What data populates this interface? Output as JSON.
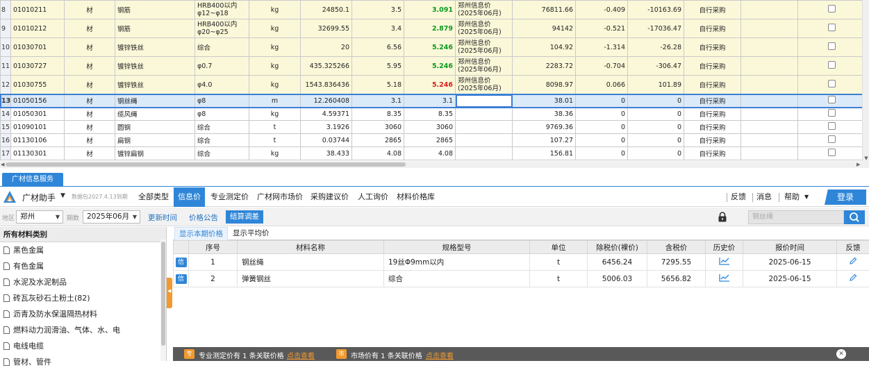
{
  "grid": {
    "rows": [
      {
        "rn": "8",
        "code": "01010211",
        "kind": "材",
        "name": "钢筋",
        "spec": "HRB400以内 φ12~φ18",
        "unit": "kg",
        "qty": "24850.1",
        "p1": "3.5",
        "p2": "3.091",
        "src": "郑州信息价(2025年06月)",
        "amt": "76811.66",
        "d1": "-0.409",
        "d2": "-10163.69",
        "mode": "自行采购",
        "style": "yellow",
        "p2color": "green"
      },
      {
        "rn": "9",
        "code": "01010212",
        "kind": "材",
        "name": "钢筋",
        "spec": "HRB400以内 φ20~φ25",
        "unit": "kg",
        "qty": "32699.55",
        "p1": "3.4",
        "p2": "2.879",
        "src": "郑州信息价(2025年06月)",
        "amt": "94142",
        "d1": "-0.521",
        "d2": "-17036.47",
        "mode": "自行采购",
        "style": "yellow",
        "p2color": "green"
      },
      {
        "rn": "10",
        "code": "01030701",
        "kind": "材",
        "name": "镀锌铁丝",
        "spec": "综合",
        "unit": "kg",
        "qty": "20",
        "p1": "6.56",
        "p2": "5.246",
        "src": "郑州信息价(2025年06月)",
        "amt": "104.92",
        "d1": "-1.314",
        "d2": "-26.28",
        "mode": "自行采购",
        "style": "yellow",
        "p2color": "green"
      },
      {
        "rn": "11",
        "code": "01030727",
        "kind": "材",
        "name": "镀锌铁丝",
        "spec": "φ0.7",
        "unit": "kg",
        "qty": "435.325266",
        "p1": "5.95",
        "p2": "5.246",
        "src": "郑州信息价(2025年06月)",
        "amt": "2283.72",
        "d1": "-0.704",
        "d2": "-306.47",
        "mode": "自行采购",
        "style": "yellow",
        "p2color": "green"
      },
      {
        "rn": "12",
        "code": "01030755",
        "kind": "材",
        "name": "镀锌铁丝",
        "spec": "φ4.0",
        "unit": "kg",
        "qty": "1543.836436",
        "p1": "5.18",
        "p2": "5.246",
        "src": "郑州信息价(2025年06月)",
        "amt": "8098.97",
        "d1": "0.066",
        "d2": "101.89",
        "mode": "自行采购",
        "style": "yellow",
        "p2color": "red"
      },
      {
        "rn": "13",
        "code": "01050156",
        "kind": "材",
        "name": "钢丝绳",
        "spec": "φ8",
        "unit": "m",
        "qty": "12.260408",
        "p1": "3.1",
        "p2": "3.1",
        "src": "",
        "amt": "38.01",
        "d1": "0",
        "d2": "0",
        "mode": "自行采购",
        "style": "sel",
        "p2color": ""
      },
      {
        "rn": "14",
        "code": "01050301",
        "kind": "材",
        "name": "缆风绳",
        "spec": "φ8",
        "unit": "kg",
        "qty": "4.59371",
        "p1": "8.35",
        "p2": "8.35",
        "src": "",
        "amt": "38.36",
        "d1": "0",
        "d2": "0",
        "mode": "自行采购",
        "style": "white",
        "p2color": ""
      },
      {
        "rn": "15",
        "code": "01090101",
        "kind": "材",
        "name": "圆钢",
        "spec": "综合",
        "unit": "t",
        "qty": "3.1926",
        "p1": "3060",
        "p2": "3060",
        "src": "",
        "amt": "9769.36",
        "d1": "0",
        "d2": "0",
        "mode": "自行采购",
        "style": "white",
        "p2color": ""
      },
      {
        "rn": "16",
        "code": "01130106",
        "kind": "材",
        "name": "扁钢",
        "spec": "综合",
        "unit": "t",
        "qty": "0.03744",
        "p1": "2865",
        "p2": "2865",
        "src": "",
        "amt": "107.27",
        "d1": "0",
        "d2": "0",
        "mode": "自行采购",
        "style": "white",
        "p2color": ""
      },
      {
        "rn": "17",
        "code": "01130301",
        "kind": "材",
        "name": "镀锌扁钢",
        "spec": "综合",
        "unit": "kg",
        "qty": "38.433",
        "p1": "4.08",
        "p2": "4.08",
        "src": "",
        "amt": "156.81",
        "d1": "0",
        "d2": "0",
        "mode": "自行采购",
        "style": "white",
        "p2color": ""
      }
    ]
  },
  "service_tab": "广材信息服务",
  "nav": {
    "brand": "广材助手",
    "expire": "数据包2027.4.13到期",
    "tabs": [
      "全部类型",
      "信息价",
      "专业测定价",
      "广材网市场价",
      "采购建议价",
      "人工询价",
      "材料价格库"
    ],
    "active_tab": "信息价",
    "feedback": "反馈",
    "message": "消息",
    "help": "帮助",
    "login": "登录"
  },
  "filter": {
    "region_label": "地区",
    "region": "郑州",
    "period_label": "期数",
    "period": "2025年06月",
    "update_time": "更新时间",
    "price_notice": "价格公告",
    "settle_adjust": "结算调差",
    "search_placeholder": "钢丝绳"
  },
  "left": {
    "title": "所有材料类别",
    "categories": [
      "黑色金属",
      "有色金属",
      "水泥及水泥制品",
      "砖瓦灰砂石土粉土(82)",
      "沥青及防水保温隔热材料",
      "燃料动力润滑油、气体、水、电",
      "电线电缆",
      "管材、管件"
    ]
  },
  "subtabs": [
    "显示本期价格",
    "显示平均价"
  ],
  "results": {
    "headers": [
      "序号",
      "材料名称",
      "规格型号",
      "单位",
      "除税价(裸价)",
      "含税价",
      "历史价",
      "报价时间",
      "反馈"
    ],
    "rows": [
      {
        "badge": "信",
        "no": "1",
        "name": "钢丝绳",
        "spec": "19丝Φ9mm以内",
        "unit": "t",
        "notax": "6456.24",
        "tax": "7295.55",
        "date": "2025-06-15"
      },
      {
        "badge": "信",
        "no": "2",
        "name": "弹簧钢丝",
        "spec": "综合",
        "unit": "t",
        "notax": "5006.03",
        "tax": "5656.82",
        "date": "2025-06-15"
      }
    ]
  },
  "notice": {
    "tag1": "专",
    "text1": "专业测定价有 1 条关联价格",
    "link1": "点击查看",
    "tag2": "市",
    "text2": "市场价有 1 条关联价格",
    "link2": "点击查看"
  },
  "colors": {
    "accent": "#2f86d8",
    "orange": "#f29a2e",
    "green_price": "#0a9a1f",
    "red_price": "#d41e1e",
    "row_yellow": "#fbf8d9"
  }
}
